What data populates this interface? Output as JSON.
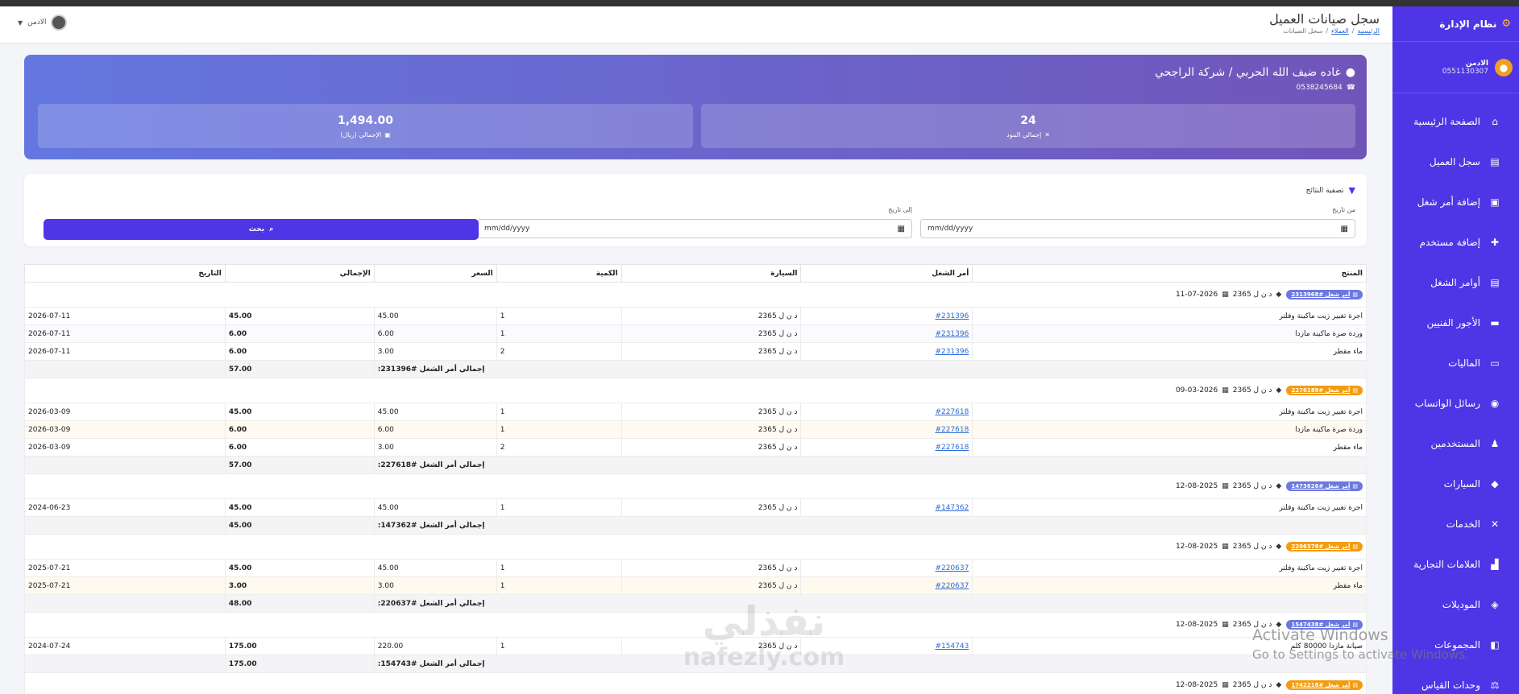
{
  "app": {
    "brand": "نظام الإدارة",
    "user_name": "الادمن",
    "user_phone": "0551130307"
  },
  "header": {
    "title": "سجل صيانات العميل",
    "breadcrumb": [
      "الرئيسية",
      "العملاء",
      "سجل الصيانات"
    ],
    "user_label": "الادمن"
  },
  "sidebar": {
    "items": [
      {
        "label": "الصفحة الرئيسية",
        "icon": "home-icon"
      },
      {
        "label": "سجل العميل",
        "icon": "clipboard-icon"
      },
      {
        "label": "إضافة أمر شغل",
        "icon": "clipboard-check-icon"
      },
      {
        "label": "إضافة مستخدم",
        "icon": "user-plus-icon"
      },
      {
        "label": "أوامر الشغل",
        "icon": "clipboard-list-icon"
      },
      {
        "label": "الأجور الفنيين",
        "icon": "money-icon"
      },
      {
        "label": "الماليات",
        "icon": "credit-card-icon"
      },
      {
        "label": "رسائل الواتساب",
        "icon": "whatsapp-icon"
      },
      {
        "label": "المستخدمين",
        "icon": "users-icon"
      },
      {
        "label": "السيارات",
        "icon": "car-icon"
      },
      {
        "label": "الخدمات",
        "icon": "tools-icon"
      },
      {
        "label": "العلامات التجارية",
        "icon": "industry-icon"
      },
      {
        "label": "الموديلات",
        "icon": "car-side-icon"
      },
      {
        "label": "المجموعات",
        "icon": "layers-icon"
      },
      {
        "label": "وحدات القياس",
        "icon": "balance-icon"
      }
    ]
  },
  "customer": {
    "name": "غاده ضيف الله الحربي / شركة الراجحي",
    "phone": "0538245684",
    "stats": {
      "items_value": "24",
      "items_label": "إجمالي البنود",
      "total_value": "1,494.00",
      "total_label": "الإجمالي (ريال)"
    }
  },
  "filter": {
    "title": "تصفية النتائج",
    "from_label": "من تاريخ",
    "to_label": "إلى تاريخ",
    "from_value": "mm/dd/yyyy",
    "to_value": "mm/dd/yyyy",
    "search_label": "بحث"
  },
  "table": {
    "headers": [
      "المنتج",
      "أمر الشغل",
      "السيارة",
      "الكمية",
      "السعر",
      "الإجمالي",
      "التاريخ"
    ],
    "groups": [
      {
        "badge": "أمر شغل #2313968",
        "badge_color": "#6c78e0",
        "car": "د ن ل 2365",
        "date": "11-07-2026",
        "rows": [
          {
            "product": "اجرة تغيير زيت ماكينة وفلتر",
            "order": "#231396",
            "car": "د ن ل 2365",
            "qty": "1",
            "price": "45.00",
            "total": "45.00",
            "date": "2026-07-11"
          },
          {
            "product": "وردة صرة ماكينة مازدا",
            "order": "#231396",
            "car": "د ن ل 2365",
            "qty": "1",
            "price": "6.00",
            "total": "6.00",
            "date": "2026-07-11"
          },
          {
            "product": "ماء مقطر",
            "order": "#231396",
            "car": "د ن ل 2365",
            "qty": "2",
            "price": "3.00",
            "total": "6.00",
            "date": "2026-07-11"
          }
        ],
        "subtotal_label": "إجمالي أمر الشغل #231396:",
        "subtotal": "57.00"
      },
      {
        "badge": "أمر شغل #2276189",
        "badge_color": "#f39c12",
        "car": "د ن ل 2365",
        "date": "09-03-2026",
        "rows": [
          {
            "product": "اجرة تغيير زيت ماكينة وفلتر",
            "order": "#227618",
            "car": "د ن ل 2365",
            "qty": "1",
            "price": "45.00",
            "total": "45.00",
            "date": "2026-03-09"
          },
          {
            "product": "وردة صرة ماكينة مازدا",
            "order": "#227618",
            "car": "د ن ل 2365",
            "qty": "1",
            "price": "6.00",
            "total": "6.00",
            "date": "2026-03-09"
          },
          {
            "product": "ماء مقطر",
            "order": "#227618",
            "car": "د ن ل 2365",
            "qty": "2",
            "price": "3.00",
            "total": "6.00",
            "date": "2026-03-09"
          }
        ],
        "subtotal_label": "إجمالي أمر الشغل #227618:",
        "subtotal": "57.00"
      },
      {
        "badge": "أمر شغل #1473626",
        "badge_color": "#6c78e0",
        "car": "د ن ل 2365",
        "date": "12-08-2025",
        "rows": [
          {
            "product": "اجرة تغيير زيت ماكينة وفلتر",
            "order": "#147362",
            "car": "د ن ل 2365",
            "qty": "1",
            "price": "45.00",
            "total": "45.00",
            "date": "2024-06-23"
          }
        ],
        "subtotal_label": "إجمالي أمر الشغل #147362:",
        "subtotal": "45.00"
      },
      {
        "badge": "أمر شغل #2206378",
        "badge_color": "#f39c12",
        "car": "د ن ل 2365",
        "date": "12-08-2025",
        "rows": [
          {
            "product": "اجرة تغيير زيت ماكينة وفلتر",
            "order": "#220637",
            "car": "د ن ل 2365",
            "qty": "1",
            "price": "45.00",
            "total": "45.00",
            "date": "2025-07-21"
          },
          {
            "product": "ماء مقطر",
            "order": "#220637",
            "car": "د ن ل 2365",
            "qty": "1",
            "price": "3.00",
            "total": "3.00",
            "date": "2025-07-21"
          }
        ],
        "subtotal_label": "إجمالي أمر الشغل #220637:",
        "subtotal": "48.00"
      },
      {
        "badge": "أمر شغل #1547438",
        "badge_color": "#6c78e0",
        "car": "د ن ل 2365",
        "date": "12-08-2025",
        "rows": [
          {
            "product": "صيانة مازدا 80000 كلم",
            "order": "#154743",
            "car": "د ن ل 2365",
            "qty": "1",
            "price": "220.00",
            "total": "175.00",
            "date": "2024-07-24"
          }
        ],
        "subtotal_label": "إجمالي أمر الشغل #154743:",
        "subtotal": "175.00"
      },
      {
        "badge": "أمر شغل #1742218",
        "badge_color": "#f39c12",
        "car": "د ن ل 2365",
        "date": "12-08-2025",
        "rows": [],
        "subtotal_label": "",
        "subtotal": ""
      }
    ]
  },
  "watermark": {
    "arabic": "نفذلي",
    "latin": "nafezly.com"
  },
  "os_notice": {
    "line1": "Activate Windows",
    "line2": "Go to Settings to activate Windows."
  }
}
